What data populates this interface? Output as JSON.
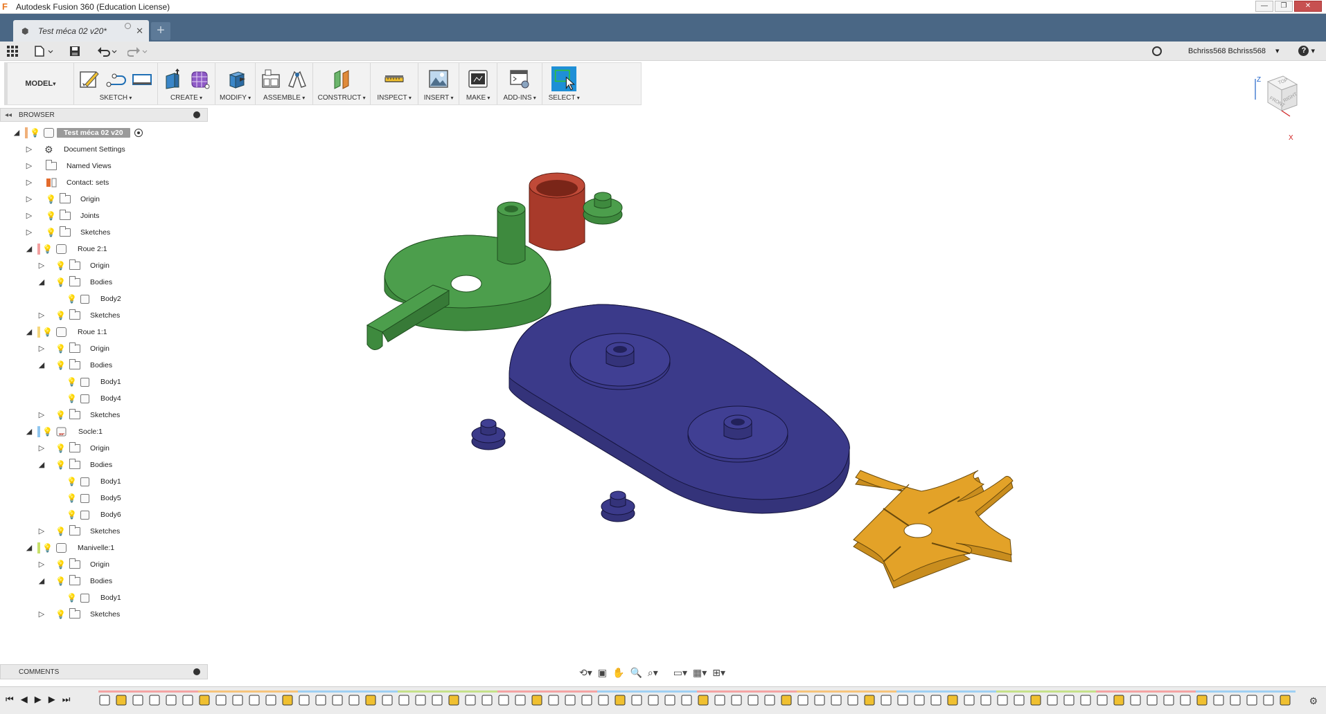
{
  "window": {
    "title": "Autodesk Fusion 360 (Education License)",
    "controls": [
      "—",
      "❐",
      "✕"
    ]
  },
  "tab": {
    "title": "Test méca 02 v20*",
    "new_tab": "+"
  },
  "quick_access": {
    "icons": [
      "grid-icon",
      "file-icon",
      "save-icon",
      "undo-icon",
      "redo-icon"
    ]
  },
  "user": {
    "name": "Bchriss568 Bchriss568",
    "help": "?"
  },
  "toolbar": {
    "workspace": "MODEL",
    "groups": [
      {
        "label": "SKETCH",
        "icons": [
          "create-sketch-icon",
          "line-icon",
          "rectangle-icon"
        ]
      },
      {
        "label": "CREATE",
        "icons": [
          "extrude-icon",
          "form-icon"
        ]
      },
      {
        "label": "MODIFY",
        "icons": [
          "press-pull-icon"
        ]
      },
      {
        "label": "ASSEMBLE",
        "icons": [
          "new-component-icon",
          "joint-icon"
        ]
      },
      {
        "label": "CONSTRUCT",
        "icons": [
          "offset-plane-icon"
        ]
      },
      {
        "label": "INSPECT",
        "icons": [
          "measure-icon"
        ]
      },
      {
        "label": "INSERT",
        "icons": [
          "insert-image-icon"
        ]
      },
      {
        "label": "MAKE",
        "icons": [
          "3d-print-icon"
        ]
      },
      {
        "label": "ADD-INS",
        "icons": [
          "scripts-icon"
        ]
      },
      {
        "label": "SELECT",
        "icons": [
          "select-icon"
        ]
      }
    ]
  },
  "browser": {
    "title": "BROWSER",
    "root": "Test méca 02 v20",
    "items": [
      {
        "label": "Document Settings"
      },
      {
        "label": "Named Views"
      },
      {
        "label": "Contact: sets"
      },
      {
        "label": "Origin"
      },
      {
        "label": "Joints"
      },
      {
        "label": "Sketches"
      },
      {
        "label": "Roue 2:1"
      },
      {
        "label": "Origin"
      },
      {
        "label": "Bodies"
      },
      {
        "label": "Body2"
      },
      {
        "label": "Sketches"
      },
      {
        "label": "Roue 1:1"
      },
      {
        "label": "Origin"
      },
      {
        "label": "Bodies"
      },
      {
        "label": "Body1"
      },
      {
        "label": "Body4"
      },
      {
        "label": "Sketches"
      },
      {
        "label": "Socle:1"
      },
      {
        "label": "Origin"
      },
      {
        "label": "Bodies"
      },
      {
        "label": "Body1"
      },
      {
        "label": "Body5"
      },
      {
        "label": "Body6"
      },
      {
        "label": "Sketches"
      },
      {
        "label": "Manivelle:1"
      },
      {
        "label": "Origin"
      },
      {
        "label": "Bodies"
      },
      {
        "label": "Body1"
      },
      {
        "label": "Sketches"
      }
    ]
  },
  "comments": {
    "title": "COMMENTS"
  },
  "viewcube": {
    "axes": [
      "Z",
      "X"
    ],
    "faces": [
      "TOP",
      "FRONT",
      "RIGHT"
    ]
  },
  "colors": {
    "tabbar": "#4a6785",
    "green_part": "#3e8a3e",
    "red_part": "#a83a2a",
    "blue_part": "#3b3a82",
    "orange_part": "#e3a228",
    "select_accent": "#1e8fd6"
  }
}
